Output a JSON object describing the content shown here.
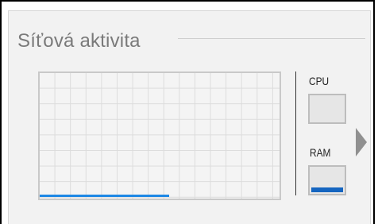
{
  "widget": {
    "title": "Síťová aktivita",
    "network_usage_fraction": 0.54
  },
  "meters": {
    "cpu": {
      "label": "CPU",
      "level_fraction": 0.0
    },
    "ram": {
      "label": "RAM",
      "level_fraction": 0.2
    }
  },
  "icons": {
    "next": "arrow-right-icon"
  },
  "colors": {
    "accent_line": "#1e88e5",
    "ram_fill": "#1565c0",
    "title_text": "#7a7a7a"
  }
}
